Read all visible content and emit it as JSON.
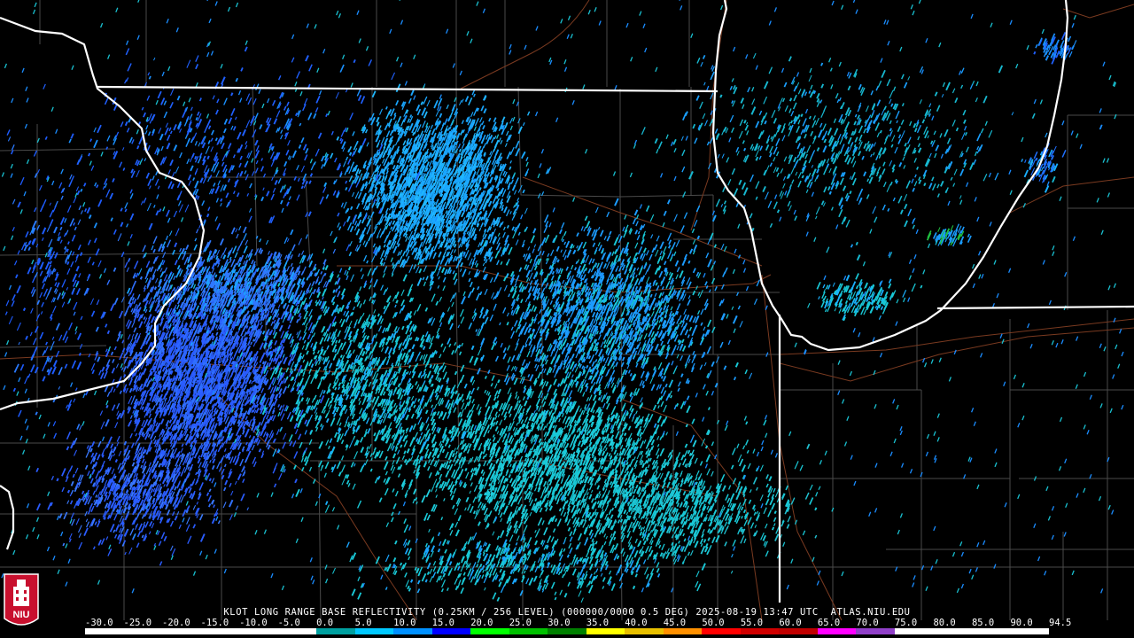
{
  "caption": "KLOT LONG RANGE BASE REFLECTIVITY (0.25KM / 256 LEVEL) (000000/0000 0.5 DEG) 2025-08-19 13:47 UTC  ATLAS.NIU.EDU",
  "logo_text": "NIU",
  "colorbar": {
    "tick_labels": [
      "-30.0",
      "-25.0",
      "-20.0",
      "-15.0",
      "-10.0",
      "-5.0",
      "0.0",
      "5.0",
      "10.0",
      "15.0",
      "20.0",
      "25.0",
      "30.0",
      "35.0",
      "40.0",
      "45.0",
      "50.0",
      "55.0",
      "60.0",
      "65.0",
      "70.0",
      "75.0",
      "80.0",
      "85.0",
      "90.0",
      "94.5"
    ],
    "colors": [
      "#ffffff",
      "#ffffff",
      "#ffffff",
      "#ffffff",
      "#ffffff",
      "#ffffff",
      "#00a0a0",
      "#00c8ff",
      "#0090ff",
      "#0000ff",
      "#00ff00",
      "#00c000",
      "#008000",
      "#ffff00",
      "#e8c000",
      "#ff9000",
      "#ff0000",
      "#d00000",
      "#c00000",
      "#ff00ff",
      "#9040c8",
      "#ffffff",
      "#ffffff",
      "#ffffff",
      "#ffffff"
    ]
  },
  "colors": {
    "background": "#000000",
    "state_border": "#ffffff",
    "county_line": "#4a4a4a",
    "highway": "#7a3a20",
    "echo_blue": "#2a5cff",
    "echo_light_blue": "#1aa6ff",
    "echo_cyan": "#19c8d6",
    "echo_green": "#20c040"
  },
  "layers": [
    "county-lines",
    "highways",
    "state-borders",
    "radar-echoes"
  ]
}
